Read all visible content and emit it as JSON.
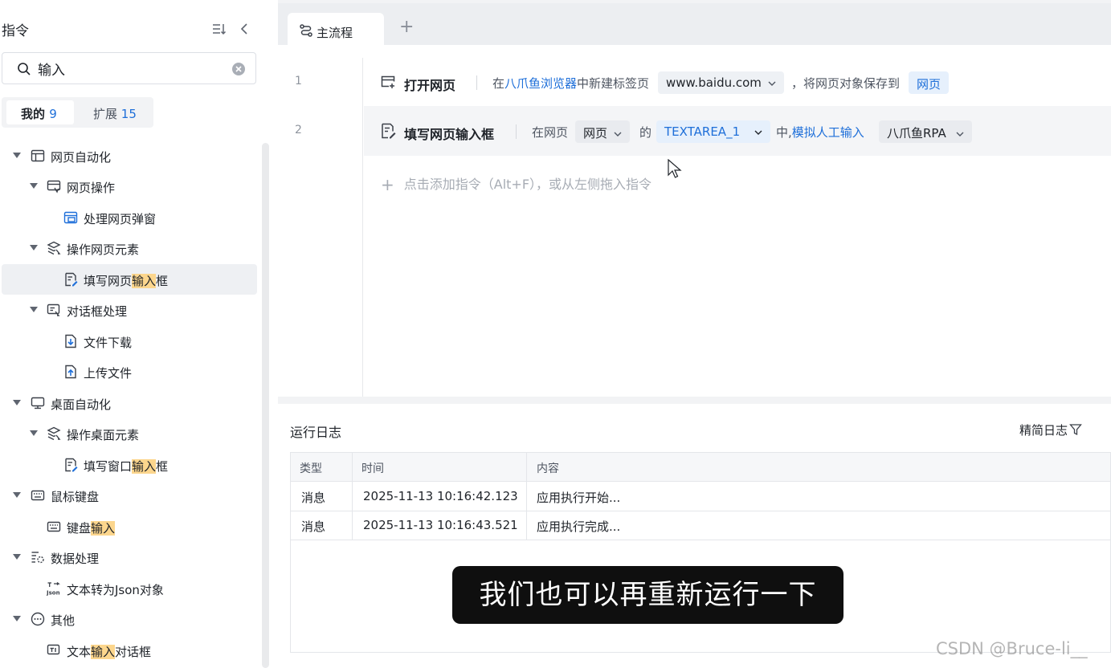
{
  "sidebar": {
    "title": "指令",
    "search": {
      "value": "输入"
    },
    "tabs": [
      {
        "label": "我的",
        "count": "9"
      },
      {
        "label": "扩展",
        "count": "15"
      }
    ],
    "tree": {
      "web_automation": "网页自动化",
      "web_ops": "网页操作",
      "handle_popup": "处理网页弹窗",
      "web_elements": "操作网页元素",
      "fill_input_pre": "填写网页",
      "fill_input_hl": "输入",
      "fill_input_post": "框",
      "dialog": "对话框处理",
      "download": "文件下载",
      "upload": "上传文件",
      "desktop": "桌面自动化",
      "desktop_elements": "操作桌面元素",
      "fill_window_pre": "填写窗口",
      "fill_window_hl": "输入",
      "fill_window_post": "框",
      "mouse_kb": "鼠标键盘",
      "kb_input_pre": "键盘",
      "kb_input_hl": "输入",
      "data_proc": "数据处理",
      "text_json": "文本转为Json对象",
      "other": "其他",
      "text_dialog_pre": "文本",
      "text_dialog_hl": "输入",
      "text_dialog_post": "对话框"
    }
  },
  "tabs": {
    "main": "主流程",
    "add": "+"
  },
  "flow": {
    "rows": [
      {
        "line": "1",
        "title": "打开网页",
        "t1": "在",
        "browser": "八爪鱼浏览器",
        "t2": "中新建标签页",
        "url": "www.baidu.com",
        "t3": "，将网页对象保存到",
        "var": "网页"
      },
      {
        "line": "2",
        "title": "填写网页输入框",
        "t1": "在网页",
        "page": "网页",
        "t2": "的",
        "element": "TEXTAREA_1",
        "t3": "中,",
        "mode": "模拟人工输入",
        "value": "八爪鱼RPA"
      }
    ],
    "add_hint": "点击添加指令（Alt+F），或从左侧拖入指令"
  },
  "log": {
    "title": "运行日志",
    "toggle": "精简日志",
    "columns": [
      "类型",
      "时间",
      "内容"
    ],
    "rows": [
      [
        "消息",
        "2025-11-13 10:16:42.123",
        "应用执行开始..."
      ],
      [
        "消息",
        "2025-11-13 10:16:43.521",
        "应用执行完成..."
      ]
    ]
  },
  "subtitle": "我们也可以再重新运行一下",
  "watermark": "CSDN @Bruce-li__"
}
